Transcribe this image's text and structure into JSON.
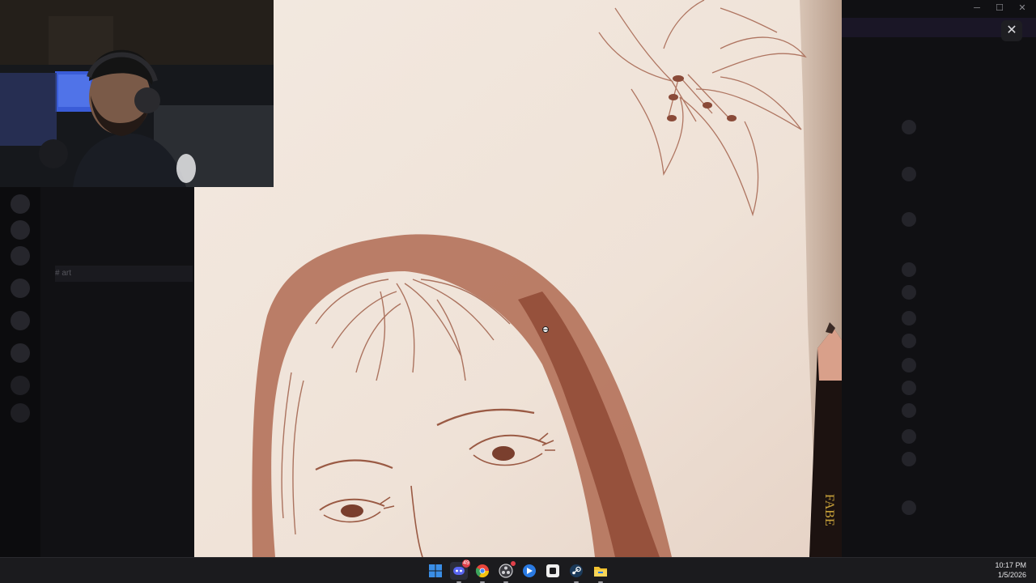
{
  "window": {
    "title": "Discord",
    "controls": {
      "minimize": "─",
      "maximize": "☐",
      "close": "✕"
    }
  },
  "viewer": {
    "close_label": "✕",
    "image_subject": "graphite sketch"
  },
  "pencil": {
    "brand_text": "FABE"
  },
  "sidebar": {
    "channels": [
      {
        "icon": "hash-icon",
        "label": "art",
        "active": true
      }
    ]
  },
  "taskbar": {
    "icons": [
      {
        "name": "windows-start-icon",
        "color": "#3a8ee6"
      },
      {
        "name": "discord-icon",
        "color": "#5865f2",
        "badge": "49"
      },
      {
        "name": "chrome-icon",
        "color": "#e8453c"
      },
      {
        "name": "obs-icon",
        "color": "#3a3a40",
        "badge": " "
      },
      {
        "name": "app-blue-icon",
        "color": "#2a7ae2"
      },
      {
        "name": "app-white-icon",
        "color": "#f0f0f0"
      },
      {
        "name": "steam-icon",
        "color": "#1b3a5a"
      },
      {
        "name": "file-explorer-icon",
        "color": "#f2c230"
      }
    ],
    "time": "10:17 PM",
    "date": "1/5/2026"
  },
  "colors": {
    "paper": "#f1e6dc",
    "sanguine": "#9a5a44",
    "taskbar": "#1b1b1e"
  }
}
